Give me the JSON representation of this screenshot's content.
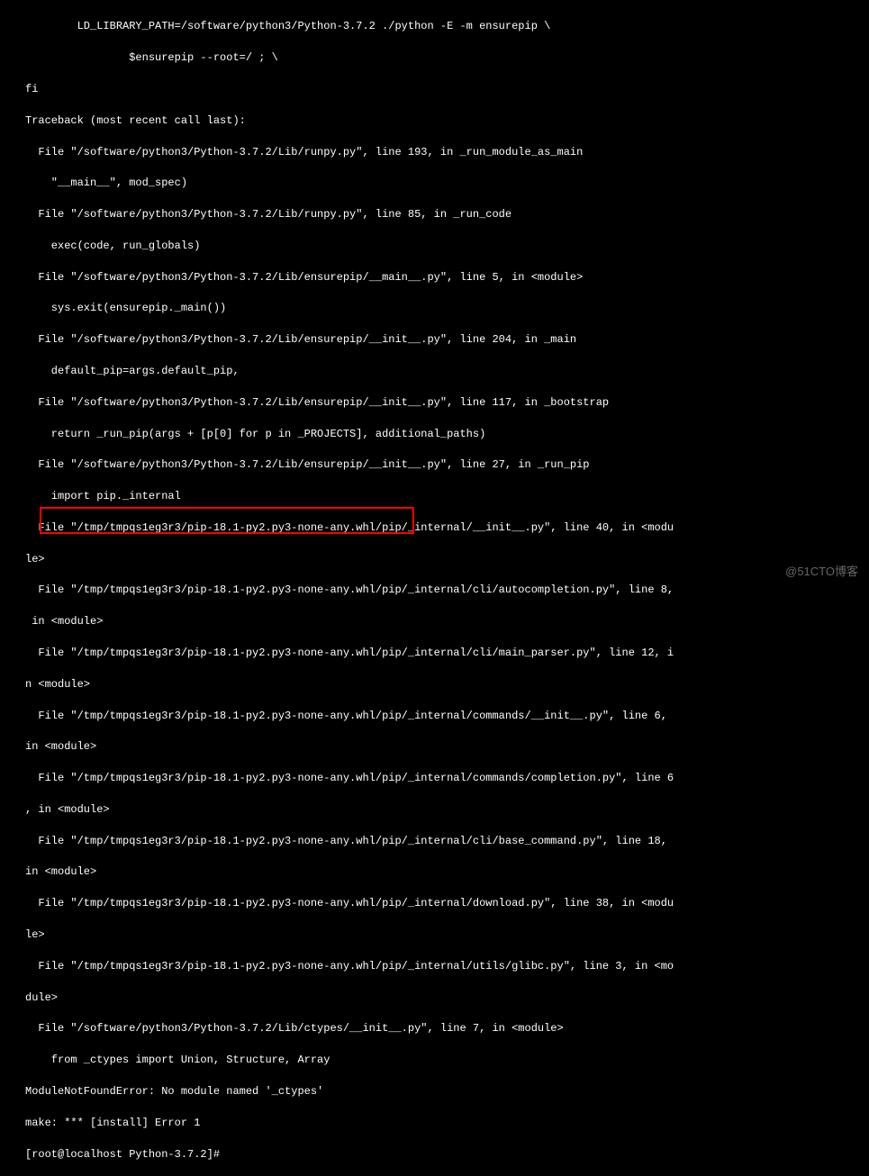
{
  "terminal": {
    "lines": [
      "        LD_LIBRARY_PATH=/software/python3/Python-3.7.2 ./python -E -m ensurepip \\",
      "                $ensurepip --root=/ ; \\",
      "fi",
      "Traceback (most recent call last):",
      "  File \"/software/python3/Python-3.7.2/Lib/runpy.py\", line 193, in _run_module_as_main",
      "    \"__main__\", mod_spec)",
      "  File \"/software/python3/Python-3.7.2/Lib/runpy.py\", line 85, in _run_code",
      "    exec(code, run_globals)",
      "  File \"/software/python3/Python-3.7.2/Lib/ensurepip/__main__.py\", line 5, in <module>",
      "    sys.exit(ensurepip._main())",
      "  File \"/software/python3/Python-3.7.2/Lib/ensurepip/__init__.py\", line 204, in _main",
      "    default_pip=args.default_pip,",
      "  File \"/software/python3/Python-3.7.2/Lib/ensurepip/__init__.py\", line 117, in _bootstrap",
      "    return _run_pip(args + [p[0] for p in _PROJECTS], additional_paths)",
      "  File \"/software/python3/Python-3.7.2/Lib/ensurepip/__init__.py\", line 27, in _run_pip",
      "    import pip._internal",
      "  File \"/tmp/tmpqs1eg3r3/pip-18.1-py2.py3-none-any.whl/pip/_internal/__init__.py\", line 40, in <modu",
      "le>",
      "  File \"/tmp/tmpqs1eg3r3/pip-18.1-py2.py3-none-any.whl/pip/_internal/cli/autocompletion.py\", line 8,",
      " in <module>",
      "  File \"/tmp/tmpqs1eg3r3/pip-18.1-py2.py3-none-any.whl/pip/_internal/cli/main_parser.py\", line 12, i",
      "n <module>",
      "  File \"/tmp/tmpqs1eg3r3/pip-18.1-py2.py3-none-any.whl/pip/_internal/commands/__init__.py\", line 6, ",
      "in <module>",
      "  File \"/tmp/tmpqs1eg3r3/pip-18.1-py2.py3-none-any.whl/pip/_internal/commands/completion.py\", line 6",
      ", in <module>",
      "  File \"/tmp/tmpqs1eg3r3/pip-18.1-py2.py3-none-any.whl/pip/_internal/cli/base_command.py\", line 18, ",
      "in <module>",
      "  File \"/tmp/tmpqs1eg3r3/pip-18.1-py2.py3-none-any.whl/pip/_internal/download.py\", line 38, in <modu",
      "le>",
      "  File \"/tmp/tmpqs1eg3r3/pip-18.1-py2.py3-none-any.whl/pip/_internal/utils/glibc.py\", line 3, in <mo",
      "dule>",
      "  File \"/software/python3/Python-3.7.2/Lib/ctypes/__init__.py\", line 7, in <module>",
      "    from _ctypes import Union, Structure, Array",
      "ModuleNotFoundError: No module named '_ctypes'",
      "make: *** [install] Error 1",
      "[root@localhost Python-3.7.2]#"
    ]
  },
  "watermark": "@51CTO博客"
}
